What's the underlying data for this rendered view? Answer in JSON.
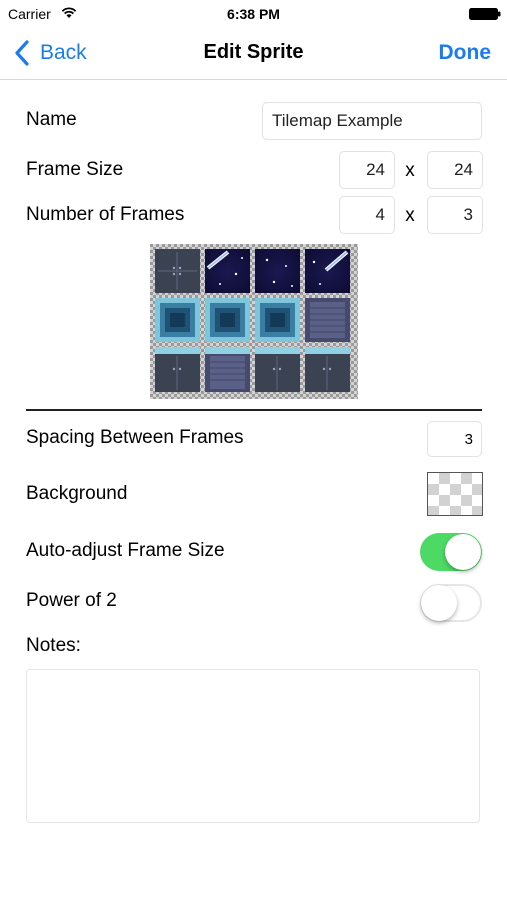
{
  "status_bar": {
    "carrier": "Carrier",
    "time": "6:38 PM"
  },
  "nav": {
    "back_label": "Back",
    "title": "Edit Sprite",
    "done_label": "Done"
  },
  "form": {
    "name_label": "Name",
    "name_value": "Tilemap Example",
    "frame_size_label": "Frame Size",
    "frame_width": "24",
    "frame_height": "24",
    "frames_label": "Number of Frames",
    "frames_x": "4",
    "frames_y": "3",
    "times_symbol": "x",
    "spacing_label": "Spacing Between Frames",
    "spacing_value": "3",
    "background_label": "Background",
    "auto_adjust_label": "Auto-adjust Frame Size",
    "auto_adjust_on": true,
    "power_of_2_label": "Power of 2",
    "power_of_2_on": false,
    "notes_label": "Notes:",
    "notes_value": ""
  },
  "sprite_preview": {
    "icon": "tilemap-sprite-grid",
    "tiles": [
      [
        "wall",
        "night-sky-beam",
        "night-sky",
        "night-sky-beam"
      ],
      [
        "water",
        "water",
        "water",
        "dark-panel"
      ],
      [
        "wall-ledge",
        "dark-panel-ledge",
        "wall-ledge",
        "wall-ledge"
      ]
    ]
  },
  "colors": {
    "accent": "#1a7cf0",
    "toggle_on": "#4cd964"
  }
}
